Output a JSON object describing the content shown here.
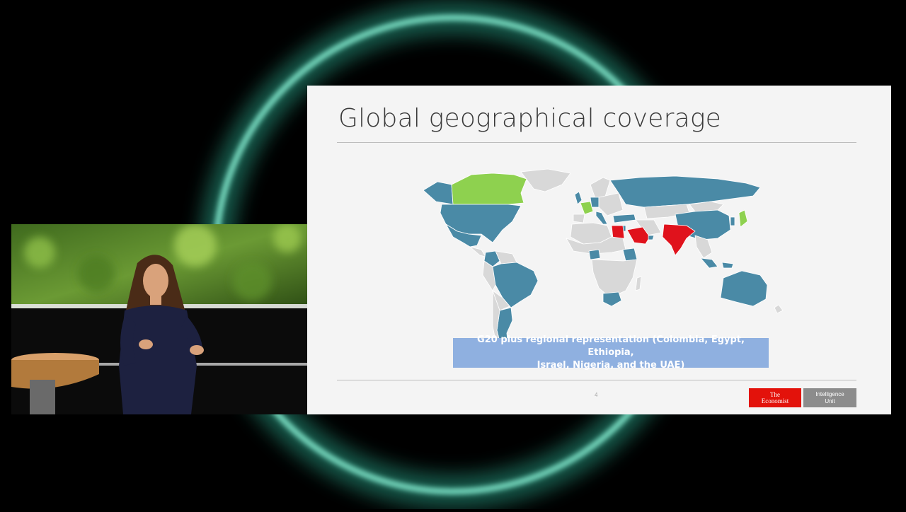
{
  "slide": {
    "title": "Global geographical coverage",
    "caption_line1": "G20 plus regional representation (Colombia, Egypt, Ethiopia,",
    "caption_line2": "Israel, Nigeria, and the UAE)",
    "page_number": "4"
  },
  "logo": {
    "economist_line1": "The",
    "economist_line2": "Economist",
    "unit_line1": "Intelligence",
    "unit_line2": "Unit"
  },
  "map_legend_colors": {
    "covered": "#4a8aa6",
    "highlight_green": "#8ed14f",
    "highlight_red": "#e0121c",
    "not_covered": "#d8d8d8"
  },
  "colors": {
    "backdrop_ring": "#5fe3c0",
    "caption_bg": "#8fb0e0",
    "economist_red": "#e3120b",
    "unit_gray": "#8c8c8c"
  }
}
